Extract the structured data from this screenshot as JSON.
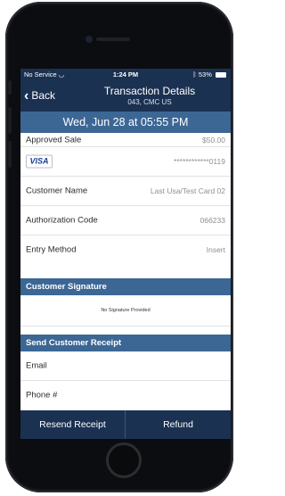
{
  "status_bar": {
    "carrier": "No Service",
    "time": "1:24 PM",
    "battery": "53%"
  },
  "nav": {
    "back_label": "Back",
    "title": "Transaction Details",
    "subtitle": "043, CMC US"
  },
  "date_banner": "Wed, Jun 28 at 05:55 PM",
  "transaction": {
    "type_label": "Approved Sale",
    "amount": "$50.00",
    "card_brand": "VISA",
    "card_number": "************0119",
    "details": [
      {
        "label": "Customer Name",
        "value": "Last Usa/Test Card 02"
      },
      {
        "label": "Authorization Code",
        "value": "066233"
      },
      {
        "label": "Entry Method",
        "value": "Insert"
      }
    ]
  },
  "signature": {
    "header": "Customer Signature",
    "text": "No Signature Provided"
  },
  "receipt": {
    "header": "Send Customer Receipt",
    "email_label": "Email",
    "phone_label": "Phone #"
  },
  "actions": {
    "resend_label": "Resend Receipt",
    "refund_label": "Refund"
  },
  "colors": {
    "navy": "#1b3152",
    "accent_blue": "#3c6795",
    "visa_blue": "#1a3f97"
  }
}
